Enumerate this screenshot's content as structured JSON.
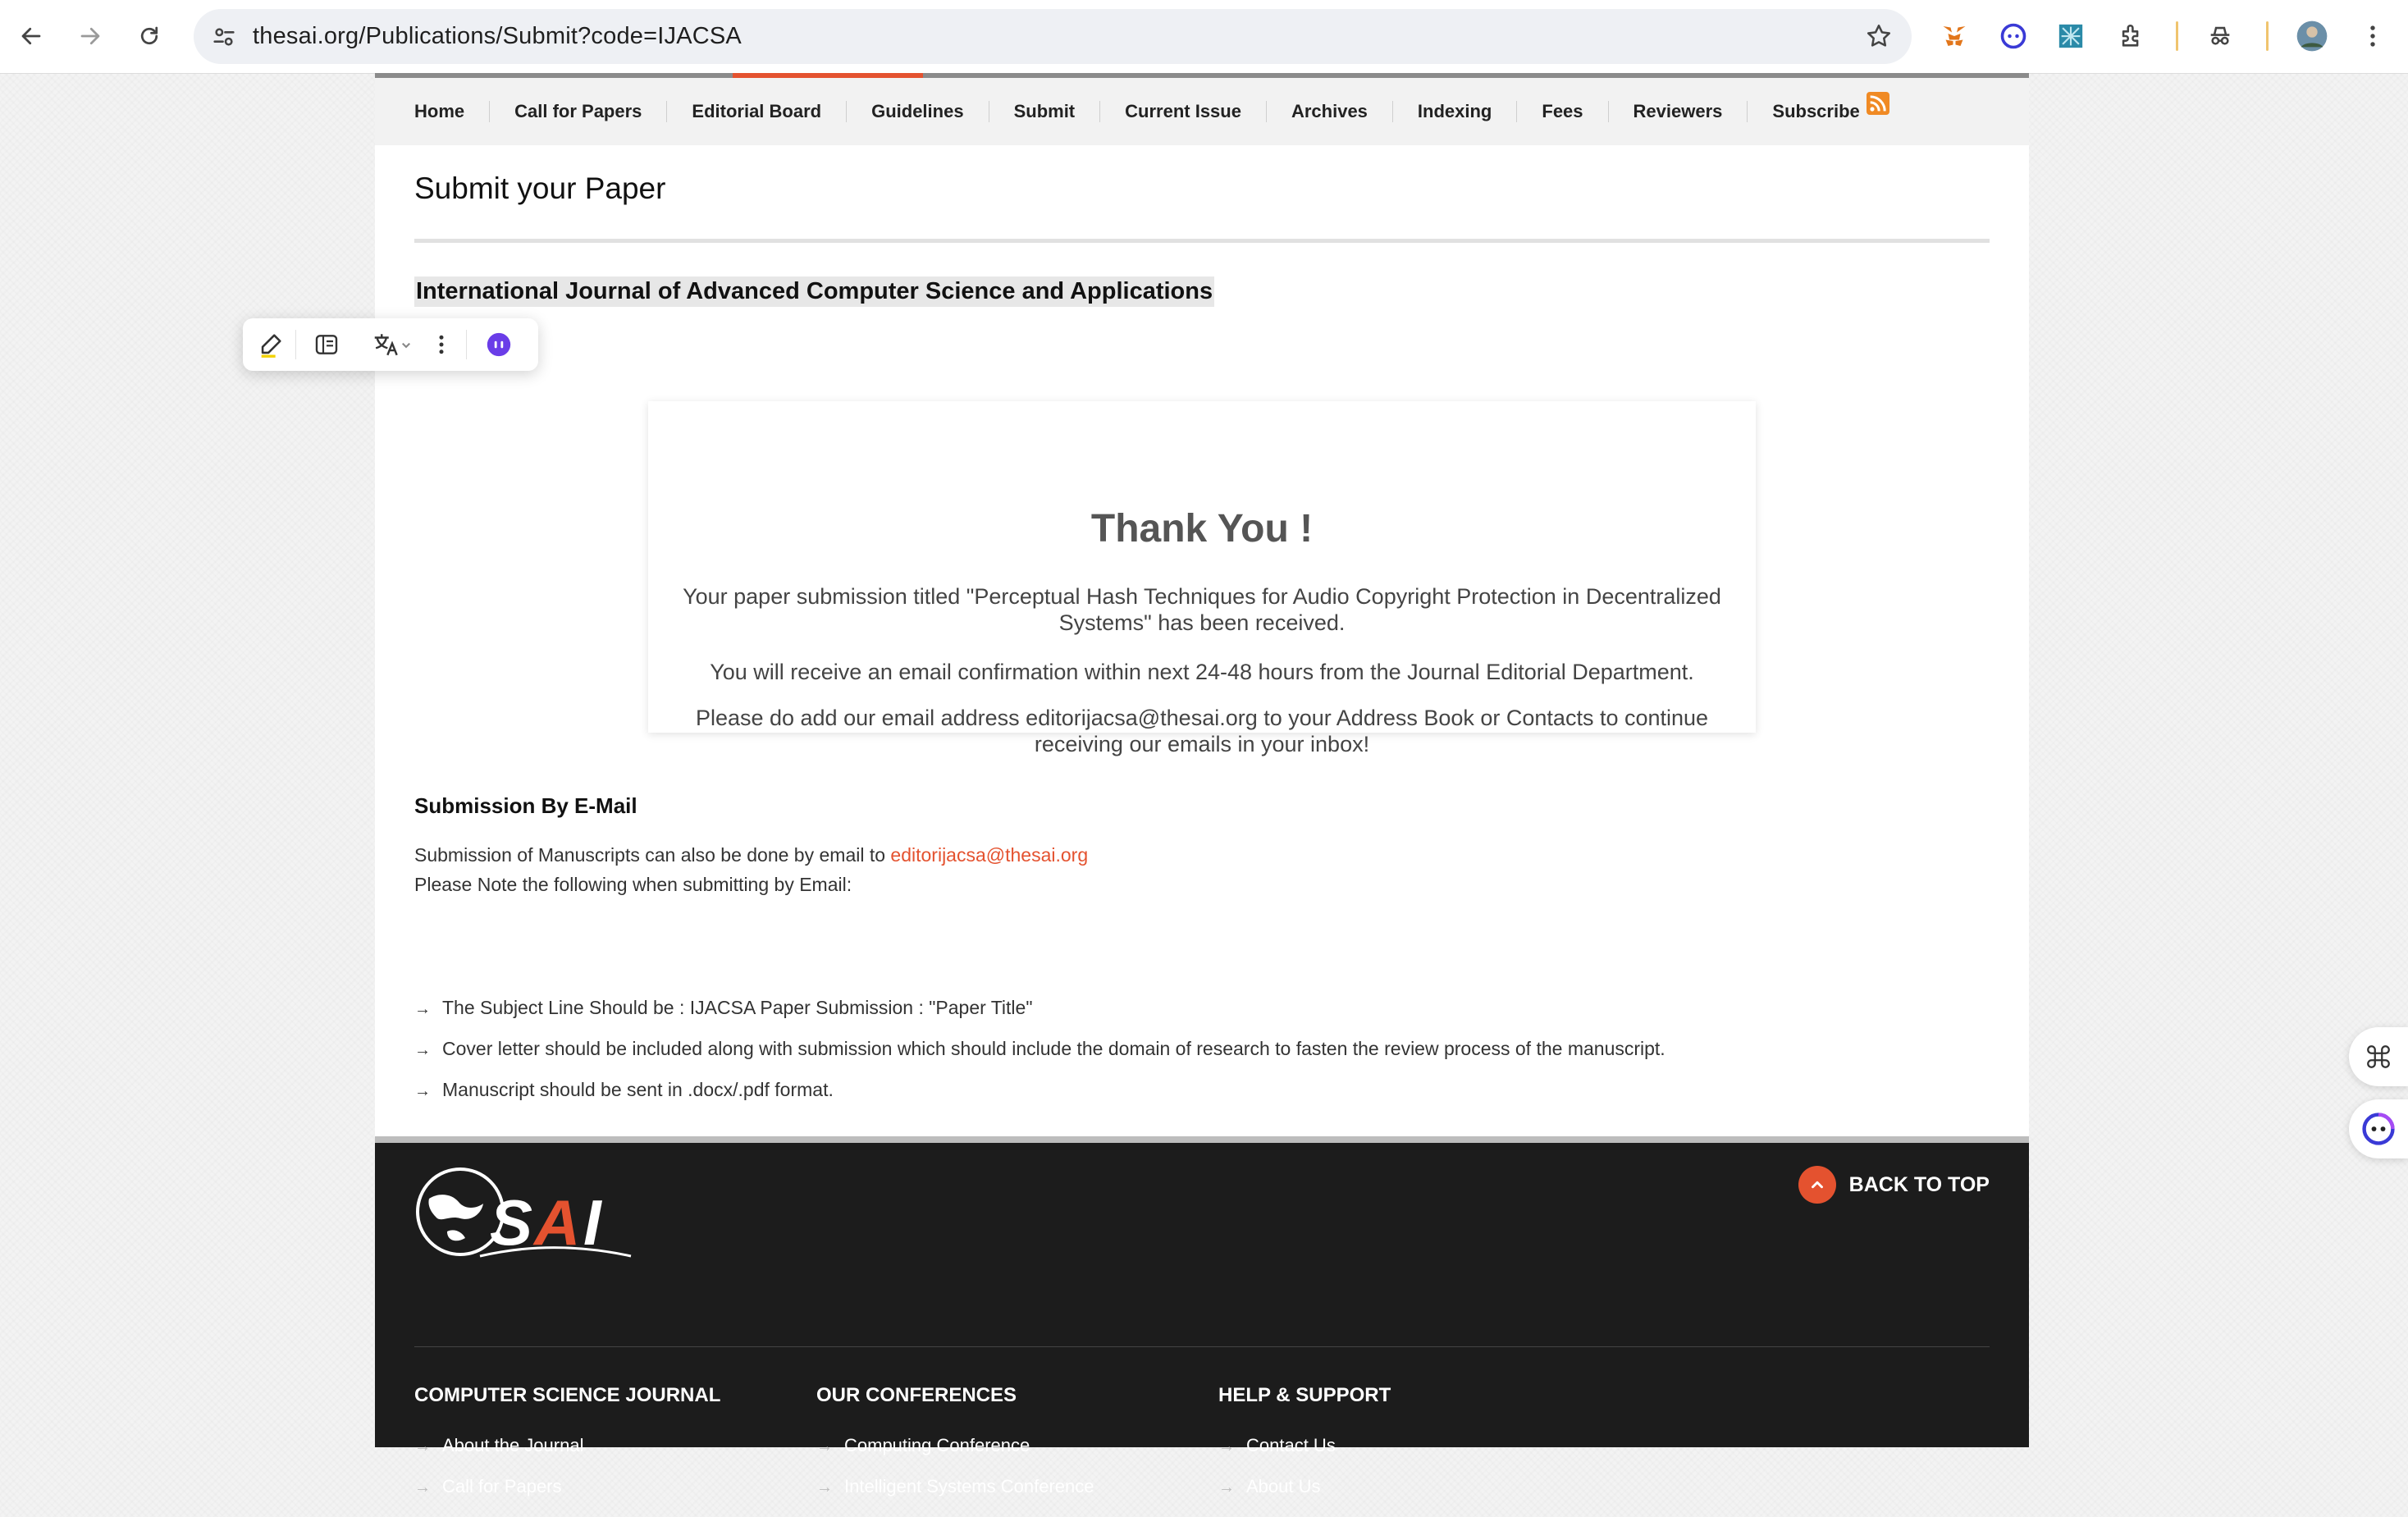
{
  "browser": {
    "url": "thesai.org/Publications/Submit?code=IJACSA"
  },
  "topnav": {
    "items": [
      "Home",
      "Call for Papers",
      "Editorial Board",
      "Guidelines",
      "Submit",
      "Current Issue",
      "Archives",
      "Indexing",
      "Fees",
      "Reviewers",
      "Subscribe"
    ]
  },
  "page": {
    "title": "Submit your Paper",
    "journal_name": "International Journal of Advanced Computer Science and Applications"
  },
  "thank_you": {
    "heading": "Thank You !",
    "p1": "Your paper submission titled \"Perceptual Hash Techniques for Audio Copyright Protection in Decentralized Systems\" has been received.",
    "p2": "You will receive an email confirmation within next 24-48 hours from the Journal Editorial Department.",
    "p3": "Please do add our email address editorijacsa@thesai.org to your Address Book or Contacts to continue receiving our emails in your inbox!"
  },
  "email_submission": {
    "heading": "Submission By E-Mail",
    "line1_prefix": "Submission of Manuscripts can also be done by email to",
    "email": "editorijacsa@thesai.org",
    "line2": "Please Note the following when submitting by Email:",
    "bullets": [
      "The Subject Line Should be : IJACSA Paper Submission : \"Paper Title\"",
      "Cover letter should be included along with submission which should include the domain of research to fasten the review process of the manuscript.",
      "Manuscript should be sent in .docx/.pdf format."
    ]
  },
  "footer": {
    "logo_text": "SAI",
    "back_to_top": "BACK TO TOP",
    "columns": [
      {
        "title": "COMPUTER SCIENCE JOURNAL",
        "links": [
          "About the Journal",
          "Call for Papers"
        ]
      },
      {
        "title": "OUR CONFERENCES",
        "links": [
          "Computing Conference",
          "Intelligent Systems Conference"
        ]
      },
      {
        "title": "HELP & SUPPORT",
        "links": [
          "Contact Us",
          "About Us"
        ]
      }
    ]
  },
  "colors": {
    "accent": "#e4522f",
    "footer_bg": "#1c1c1c"
  }
}
